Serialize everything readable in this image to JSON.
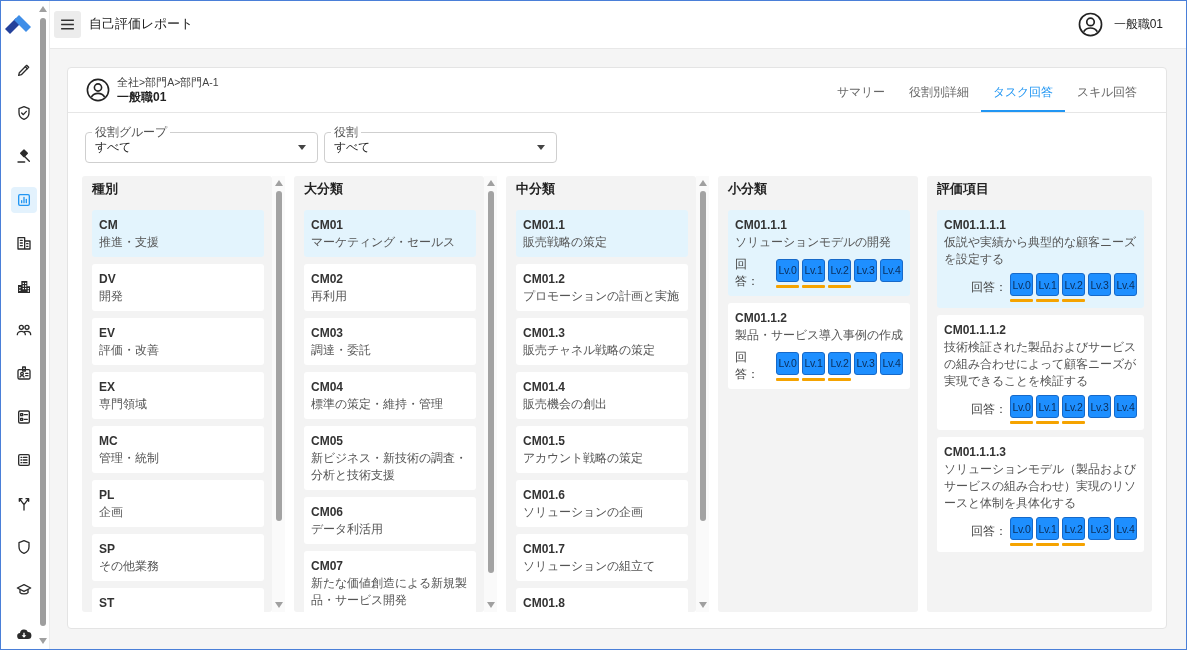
{
  "app": {
    "title": "自己評価レポート",
    "user": "一般職01"
  },
  "sidebar": {
    "items": [
      {
        "selected": false
      },
      {
        "selected": false
      },
      {
        "selected": false
      },
      {
        "selected": true
      },
      {
        "selected": false
      },
      {
        "selected": false
      },
      {
        "selected": false
      },
      {
        "selected": false
      },
      {
        "selected": false
      },
      {
        "selected": false
      },
      {
        "selected": false
      },
      {
        "selected": false
      },
      {
        "selected": false
      },
      {
        "selected": false
      }
    ]
  },
  "profile": {
    "breadcrumb": "全社>部門A>部門A-1",
    "name": "一般職01"
  },
  "tabs": [
    {
      "label": "サマリー",
      "selected": false
    },
    {
      "label": "役割別詳細",
      "selected": false
    },
    {
      "label": "タスク回答",
      "selected": true
    },
    {
      "label": "スキル回答",
      "selected": false
    }
  ],
  "filters": [
    {
      "label": "役割グループ",
      "value": "すべて"
    },
    {
      "label": "役割",
      "value": "すべて"
    }
  ],
  "columns": [
    {
      "title": "種別",
      "items": [
        {
          "code": "CM",
          "name": "推進・支援",
          "selected": true
        },
        {
          "code": "DV",
          "name": "開発",
          "selected": false
        },
        {
          "code": "EV",
          "name": "評価・改善",
          "selected": false
        },
        {
          "code": "EX",
          "name": "専門領域",
          "selected": false
        },
        {
          "code": "MC",
          "name": "管理・統制",
          "selected": false
        },
        {
          "code": "PL",
          "name": "企画",
          "selected": false
        },
        {
          "code": "SP",
          "name": "その他業務",
          "selected": false
        },
        {
          "code": "ST",
          "selected": false
        }
      ]
    },
    {
      "title": "大分類",
      "items": [
        {
          "code": "CM01",
          "name": "マーケティング・セールス",
          "selected": true
        },
        {
          "code": "CM02",
          "name": "再利用",
          "selected": false
        },
        {
          "code": "CM03",
          "name": "調達・委託",
          "selected": false
        },
        {
          "code": "CM04",
          "name": "標準の策定・維持・管理",
          "selected": false
        },
        {
          "code": "CM05",
          "name": "新ビジネス・新技術の調査・分析と技術支援",
          "selected": false
        },
        {
          "code": "CM06",
          "name": "データ利活用",
          "selected": false
        },
        {
          "code": "CM07",
          "name": "新たな価値創造による新規製品・サービス開発",
          "selected": false
        }
      ]
    },
    {
      "title": "中分類",
      "items": [
        {
          "code": "CM01.1",
          "name": "販売戦略の策定",
          "selected": true
        },
        {
          "code": "CM01.2",
          "name": "プロモーションの計画と実施",
          "selected": false
        },
        {
          "code": "CM01.3",
          "name": "販売チャネル戦略の策定",
          "selected": false
        },
        {
          "code": "CM01.4",
          "name": "販売機会の創出",
          "selected": false
        },
        {
          "code": "CM01.5",
          "name": "アカウント戦略の策定",
          "selected": false
        },
        {
          "code": "CM01.6",
          "name": "ソリューションの企画",
          "selected": false
        },
        {
          "code": "CM01.7",
          "name": "ソリューションの組立て",
          "selected": false
        },
        {
          "code": "CM01.8",
          "selected": false
        }
      ]
    },
    {
      "title": "小分類",
      "items": [
        {
          "code": "CM01.1.1",
          "name": "ソリューションモデルの開発",
          "selected": true,
          "answer_label": "回答：",
          "levels": [
            {
              "label": "Lv.0",
              "achieved": true
            },
            {
              "label": "Lv.1",
              "achieved": true
            },
            {
              "label": "Lv.2",
              "achieved": true
            },
            {
              "label": "Lv.3",
              "achieved": false
            },
            {
              "label": "Lv.4",
              "achieved": false
            }
          ]
        },
        {
          "code": "CM01.1.2",
          "name": "製品・サービス導入事例の作成",
          "selected": false,
          "answer_label": "回答：",
          "levels": [
            {
              "label": "Lv.0",
              "achieved": true
            },
            {
              "label": "Lv.1",
              "achieved": true
            },
            {
              "label": "Lv.2",
              "achieved": true
            },
            {
              "label": "Lv.3",
              "achieved": false
            },
            {
              "label": "Lv.4",
              "achieved": false
            }
          ]
        }
      ]
    },
    {
      "title": "評価項目",
      "items": [
        {
          "code": "CM01.1.1.1",
          "name": "仮説や実績から典型的な顧客ニーズを設定する",
          "selected": true,
          "answer_label": "回答：",
          "levels": [
            {
              "label": "Lv.0",
              "achieved": true
            },
            {
              "label": "Lv.1",
              "achieved": true
            },
            {
              "label": "Lv.2",
              "achieved": true
            },
            {
              "label": "Lv.3",
              "achieved": false
            },
            {
              "label": "Lv.4",
              "achieved": false
            }
          ]
        },
        {
          "code": "CM01.1.1.2",
          "name": "技術検証された製品およびサービスの組み合わせによって顧客ニーズが実現できることを検証する",
          "selected": false,
          "answer_label": "回答：",
          "levels": [
            {
              "label": "Lv.0",
              "achieved": true
            },
            {
              "label": "Lv.1",
              "achieved": true
            },
            {
              "label": "Lv.2",
              "achieved": true
            },
            {
              "label": "Lv.3",
              "achieved": false
            },
            {
              "label": "Lv.4",
              "achieved": false
            }
          ]
        },
        {
          "code": "CM01.1.1.3",
          "name": "ソリューションモデル（製品およびサービスの組み合わせ）実現のリソースと体制を具体化する",
          "selected": false,
          "answer_label": "回答：",
          "levels": [
            {
              "label": "Lv.0",
              "achieved": true
            },
            {
              "label": "Lv.1",
              "achieved": true
            },
            {
              "label": "Lv.2",
              "achieved": true
            },
            {
              "label": "Lv.3",
              "achieved": false
            },
            {
              "label": "Lv.4",
              "achieved": false
            }
          ]
        }
      ]
    }
  ]
}
